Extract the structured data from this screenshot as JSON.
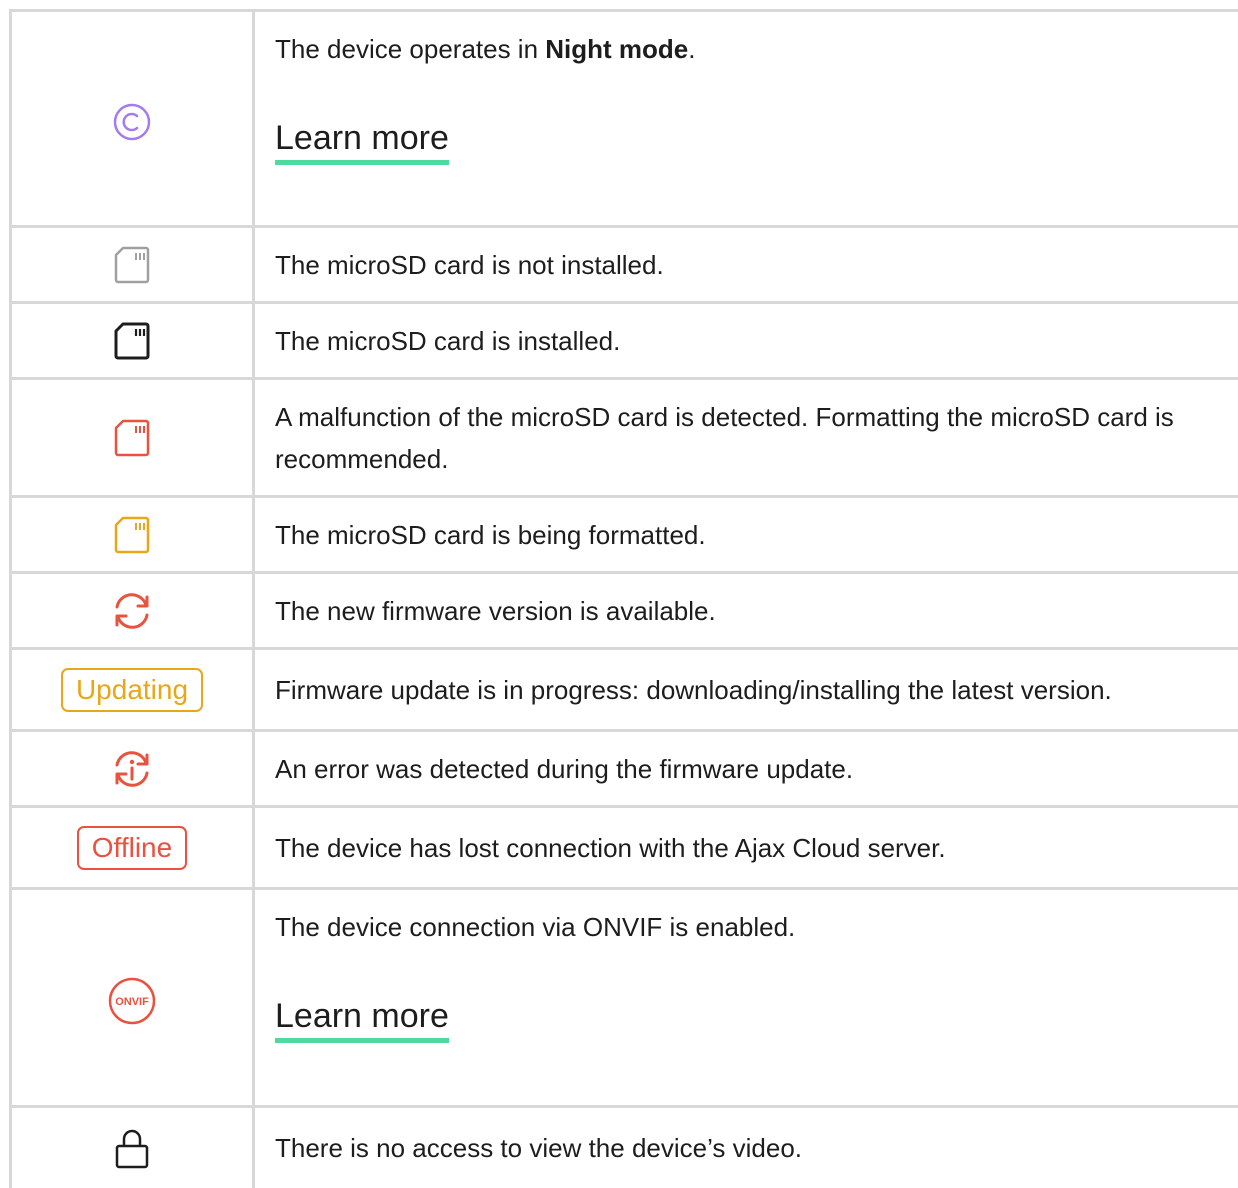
{
  "rows": [
    {
      "icon": "night-mode-icon",
      "text_before": "The device operates in ",
      "text_bold": "Night mode",
      "text_after": ".",
      "link": "Learn more"
    },
    {
      "icon": "microsd-not-installed-icon",
      "text": "The microSD card is not installed."
    },
    {
      "icon": "microsd-installed-icon",
      "text": "The microSD card is installed."
    },
    {
      "icon": "microsd-malfunction-icon",
      "text": "A malfunction of the microSD card is detected. Formatting the microSD card is recommended."
    },
    {
      "icon": "microsd-formatting-icon",
      "text": "The microSD card is being formatted."
    },
    {
      "icon": "firmware-available-icon",
      "text": "The new firmware version is available."
    },
    {
      "badge": "Updating",
      "text": "Firmware update is in progress: downloading/installing the latest version."
    },
    {
      "icon": "firmware-error-icon",
      "text": "An error was detected during the firmware update."
    },
    {
      "badge": "Offline",
      "text": "The device has lost connection with the Ajax Cloud server."
    },
    {
      "icon": "onvif-icon",
      "icon_text": "ONVIF",
      "text": "The device connection via ONVIF is enabled.",
      "link": "Learn more"
    },
    {
      "icon": "lock-icon",
      "text": "There is no access to view the device’s video."
    }
  ],
  "colors": {
    "purple": "#a57bf0",
    "gray": "#a0a0a0",
    "black": "#1d1d1d",
    "red": "#e8523f",
    "yellow": "#e8a719",
    "link_underline": "#4ed99e"
  }
}
